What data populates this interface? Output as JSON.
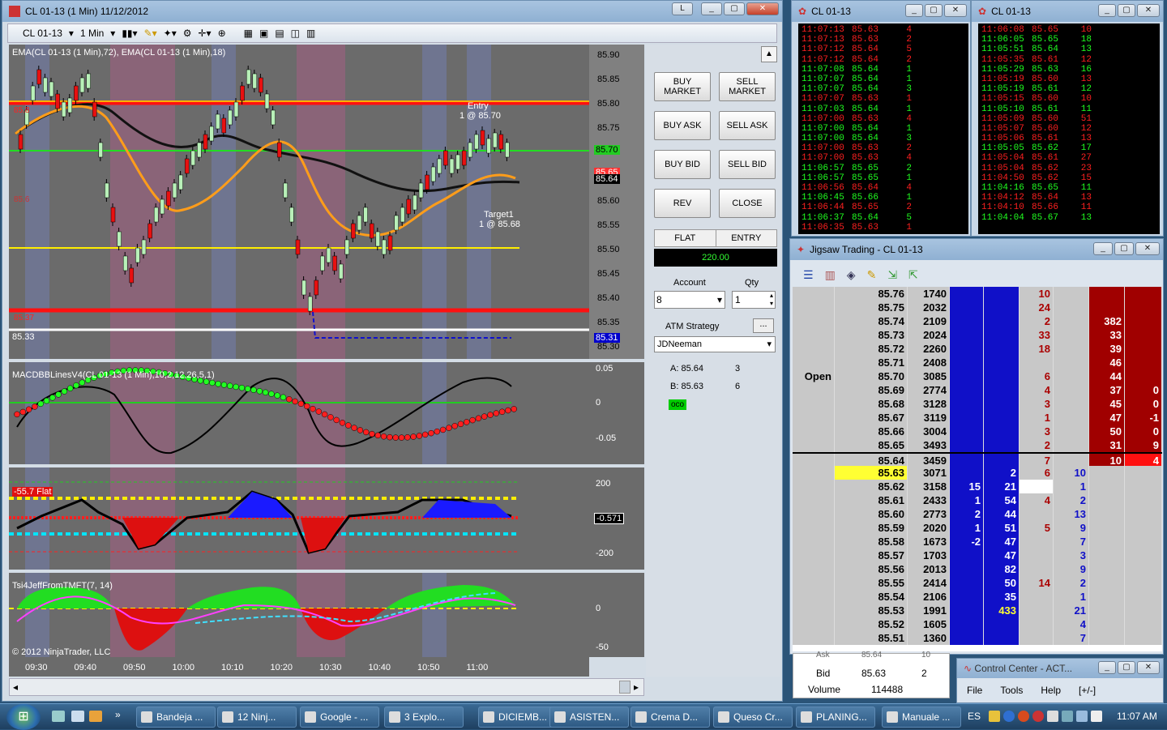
{
  "main_window": {
    "title": "CL 01-13 (1 Min)  11/12/2012",
    "toolbar": {
      "instrument": "CL 01-13",
      "interval": "1 Min"
    }
  },
  "chart": {
    "indicator_label": "EMA(CL 01-13 (1 Min),72), EMA(CL 01-13 (1 Min),18)",
    "price_ticks": [
      "85.90",
      "85.85",
      "85.80",
      "85.75",
      "85.70",
      "85.65",
      "85.60",
      "85.55",
      "85.50",
      "85.45",
      "85.40",
      "85.35",
      "85.30"
    ],
    "price_markers": {
      "upper": "85.70",
      "mid_a": "85.65",
      "last": "85.64",
      "low": "85.31"
    },
    "entry_label": "Entry",
    "entry_fill": "1 @ 85.70",
    "target_label": "Target1",
    "target_fill": "1 @ 85.68",
    "line_label_high": "85.8",
    "line_label_stop": "85.37",
    "line_label_mid": "85.6",
    "low_label": "85.33",
    "macd_label": "MACDBBLinesV4(CL 01-13 (1 Min),10,2,12,26,5,1)",
    "macd_ticks": [
      "0.05",
      "0",
      "-0.05"
    ],
    "osc_ticks": [
      "200",
      "-200"
    ],
    "osc_value": "-0.571",
    "osc_badge": "-55.7 Flat",
    "tsi_label": "Tsi4JeffFromTMFT(7, 14)",
    "tsi_ticks": [
      "0",
      "-50"
    ],
    "copyright": "© 2012 NinjaTrader, LLC",
    "time_ticks": [
      "09:30",
      "09:40",
      "09:50",
      "10:00",
      "10:10",
      "10:20",
      "10:30",
      "10:40",
      "10:50",
      "11:00"
    ]
  },
  "order_panel": {
    "buy_market": "BUY MARKET",
    "sell_market": "SELL MARKET",
    "buy_ask": "BUY ASK",
    "sell_ask": "SELL ASK",
    "buy_bid": "BUY BID",
    "sell_bid": "SELL BID",
    "rev": "REV",
    "close": "CLOSE",
    "flat": "FLAT",
    "entry": "ENTRY",
    "pnl": "220.00",
    "account_label": "Account",
    "account_value": "8",
    "qty_label": "Qty",
    "qty_value": "1",
    "atm_label": "ATM Strategy",
    "atm_more": "...",
    "atm_value": "JDNeeman",
    "ask_line": "A: 85.64",
    "ask_qty": "3",
    "bid_line": "B: 85.63",
    "bid_qty": "6",
    "oco": "oco"
  },
  "tns_left": {
    "title": "CL 01-13",
    "rows": [
      [
        "11:07:13",
        "85.63",
        "4",
        "red"
      ],
      [
        "11:07:13",
        "85.63",
        "2",
        "red"
      ],
      [
        "11:07:12",
        "85.64",
        "5",
        "red"
      ],
      [
        "11:07:12",
        "85.64",
        "2",
        "red"
      ],
      [
        "11:07:08",
        "85.64",
        "1",
        "green"
      ],
      [
        "11:07:07",
        "85.64",
        "1",
        "green"
      ],
      [
        "11:07:07",
        "85.64",
        "3",
        "green"
      ],
      [
        "11:07:07",
        "85.63",
        "1",
        "red"
      ],
      [
        "11:07:03",
        "85.64",
        "1",
        "green"
      ],
      [
        "11:07:00",
        "85.63",
        "4",
        "red"
      ],
      [
        "11:07:00",
        "85.64",
        "1",
        "green"
      ],
      [
        "11:07:00",
        "85.64",
        "3",
        "green"
      ],
      [
        "11:07:00",
        "85.63",
        "2",
        "red"
      ],
      [
        "11:07:00",
        "85.63",
        "4",
        "red"
      ],
      [
        "11:06:57",
        "85.65",
        "2",
        "green"
      ],
      [
        "11:06:57",
        "85.65",
        "1",
        "green"
      ],
      [
        "11:06:56",
        "85.64",
        "4",
        "red"
      ],
      [
        "11:06:45",
        "85.66",
        "1",
        "green"
      ],
      [
        "11:06:44",
        "85.65",
        "2",
        "red"
      ],
      [
        "11:06:37",
        "85.64",
        "5",
        "green"
      ],
      [
        "11:06:35",
        "85.63",
        "1",
        "red"
      ]
    ]
  },
  "tns_right": {
    "title": "CL 01-13",
    "rows": [
      [
        "11:06:08",
        "85.65",
        "10",
        "red"
      ],
      [
        "11:06:05",
        "85.65",
        "18",
        "green"
      ],
      [
        "11:05:51",
        "85.64",
        "13",
        "green"
      ],
      [
        "11:05:35",
        "85.61",
        "12",
        "red"
      ],
      [
        "11:05:29",
        "85.63",
        "16",
        "green"
      ],
      [
        "11:05:19",
        "85.60",
        "13",
        "red"
      ],
      [
        "11:05:19",
        "85.61",
        "12",
        "green"
      ],
      [
        "11:05:15",
        "85.60",
        "10",
        "red"
      ],
      [
        "11:05:10",
        "85.61",
        "11",
        "green"
      ],
      [
        "11:05:09",
        "85.60",
        "51",
        "red"
      ],
      [
        "11:05:07",
        "85.60",
        "12",
        "red"
      ],
      [
        "11:05:06",
        "85.61",
        "13",
        "red"
      ],
      [
        "11:05:05",
        "85.62",
        "17",
        "green"
      ],
      [
        "11:05:04",
        "85.61",
        "27",
        "red"
      ],
      [
        "11:05:04",
        "85.62",
        "23",
        "red"
      ],
      [
        "11:04:50",
        "85.62",
        "15",
        "red"
      ],
      [
        "11:04:16",
        "85.65",
        "11",
        "green"
      ],
      [
        "11:04:12",
        "85.64",
        "13",
        "red"
      ],
      [
        "11:04:10",
        "85.66",
        "11",
        "red"
      ],
      [
        "11:04:04",
        "85.67",
        "13",
        "green"
      ]
    ]
  },
  "jigsaw": {
    "title": "Jigsaw Trading - CL 01-13",
    "open_label": "Open",
    "rows": [
      [
        "",
        "85.76",
        "1740",
        "",
        "",
        "10",
        "",
        "",
        ""
      ],
      [
        "",
        "85.75",
        "2032",
        "",
        "",
        "24",
        "",
        "",
        ""
      ],
      [
        "",
        "85.74",
        "2109",
        "",
        "",
        "2",
        "",
        "382",
        ""
      ],
      [
        "",
        "85.73",
        "2024",
        "",
        "",
        "33",
        "",
        "33",
        ""
      ],
      [
        "",
        "85.72",
        "2260",
        "",
        "",
        "18",
        "",
        "39",
        ""
      ],
      [
        "",
        "85.71",
        "2408",
        "",
        "",
        "",
        "",
        "46",
        ""
      ],
      [
        "Open",
        "85.70",
        "3085",
        "",
        "",
        "6",
        "",
        "44",
        ""
      ],
      [
        "",
        "85.69",
        "2774",
        "",
        "",
        "4",
        "",
        "37",
        "0"
      ],
      [
        "",
        "85.68",
        "3128",
        "",
        "",
        "3",
        "",
        "45",
        "0"
      ],
      [
        "",
        "85.67",
        "3119",
        "",
        "",
        "1",
        "",
        "47",
        "-1"
      ],
      [
        "",
        "85.66",
        "3004",
        "",
        "",
        "3",
        "",
        "50",
        "0"
      ],
      [
        "",
        "85.65",
        "3493",
        "",
        "",
        "2",
        "",
        "31",
        "9"
      ],
      [
        "",
        "85.64",
        "3459",
        "",
        "",
        "7",
        "",
        "10",
        "4"
      ],
      [
        "",
        "85.63",
        "3071",
        "",
        "2",
        "6",
        "10",
        "",
        ""
      ],
      [
        "",
        "85.62",
        "3158",
        "15",
        "21",
        "",
        "1",
        "",
        ""
      ],
      [
        "",
        "85.61",
        "2433",
        "1",
        "54",
        "4",
        "2",
        "",
        ""
      ],
      [
        "",
        "85.60",
        "2773",
        "2",
        "44",
        "",
        "13",
        "",
        ""
      ],
      [
        "",
        "85.59",
        "2020",
        "1",
        "51",
        "5",
        "9",
        "",
        ""
      ],
      [
        "",
        "85.58",
        "1673",
        "-2",
        "47",
        "",
        "7",
        "",
        ""
      ],
      [
        "",
        "85.57",
        "1703",
        "",
        "47",
        "",
        "3",
        "",
        ""
      ],
      [
        "",
        "85.56",
        "2013",
        "",
        "82",
        "",
        "9",
        "",
        ""
      ],
      [
        "",
        "85.55",
        "2414",
        "",
        "50",
        "14",
        "2",
        "",
        ""
      ],
      [
        "",
        "85.54",
        "2106",
        "",
        "35",
        "",
        "1",
        "",
        ""
      ],
      [
        "",
        "85.53",
        "1991",
        "",
        "433",
        "",
        "21",
        "",
        ""
      ],
      [
        "",
        "85.52",
        "1605",
        "",
        "",
        "",
        "4",
        "",
        ""
      ],
      [
        "",
        "85.51",
        "1360",
        "",
        "",
        "",
        "7",
        "",
        ""
      ]
    ]
  },
  "market_box": {
    "ask_label": "Ask",
    "ask_val": "85.64",
    "ask_size": "10",
    "bid_label": "Bid",
    "bid_val": "85.63",
    "bid_size": "2",
    "volume_label": "Volume",
    "volume_val": "114488"
  },
  "control_center": {
    "title": "Control Center - ACT...",
    "menu": [
      "File",
      "Tools",
      "Help",
      "[+/-]"
    ]
  },
  "taskbar": {
    "items": [
      "Bandeja ...",
      "12 Ninj...",
      "Google - ...",
      "3 Explo...",
      "DICIEMB...",
      "ASISTEN...",
      "Crema D...",
      "Queso Cr...",
      "PLANING...",
      "Manuale ..."
    ],
    "lang": "ES",
    "clock": "11:07 AM"
  }
}
